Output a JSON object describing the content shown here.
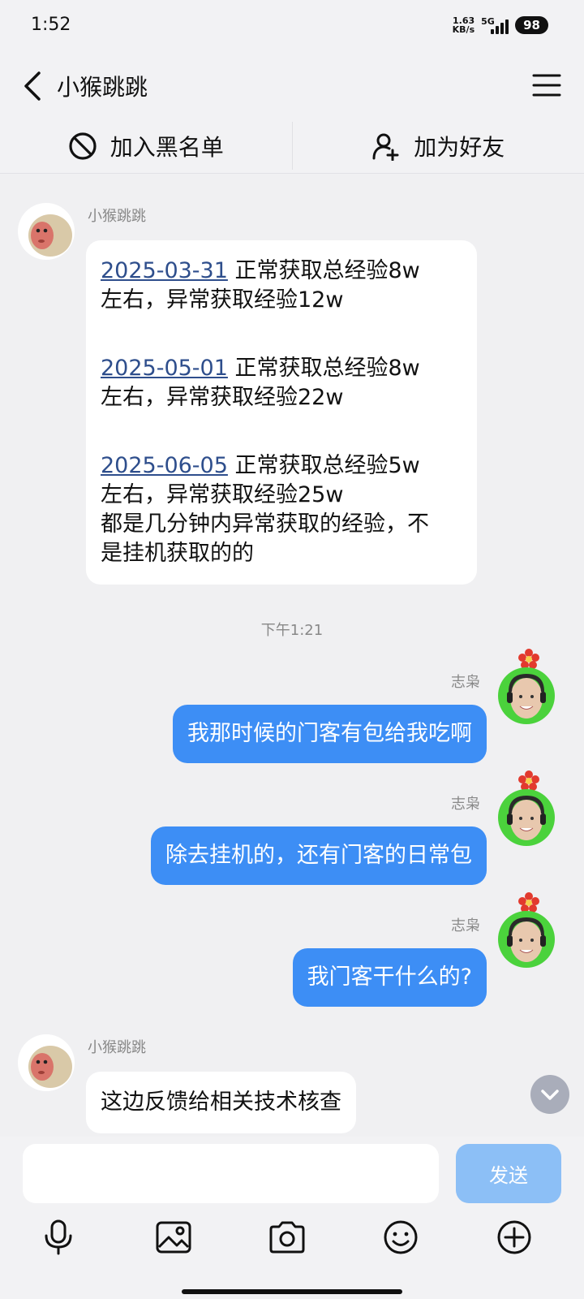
{
  "status_bar": {
    "time": "1:52",
    "net_speed_value": "1.63",
    "net_speed_unit": "KB/s",
    "network": "5G",
    "battery": "98"
  },
  "header": {
    "title": "小猴跳跳"
  },
  "actions": {
    "block_label": "加入黑名单",
    "add_friend_label": "加为好友"
  },
  "chat": {
    "first_message": {
      "sender": "小猴跳跳",
      "entries": [
        {
          "date": "2025-03-31",
          "text1": " 正常获取总经验8w",
          "text2": "左右，异常获取经验12w"
        },
        {
          "date": "2025-05-01",
          "text1": " 正常获取总经验8w",
          "text2": "左右，异常获取经验22w"
        },
        {
          "date": "2025-06-05",
          "text1": " 正常获取总经验5w",
          "text2": "左右，异常获取经验25w"
        }
      ],
      "footer_line1": "都是几分钟内异常获取的经验，不",
      "footer_line2": "是挂机获取的的"
    },
    "timestamp": "下午1:21",
    "outgoing": [
      {
        "sender": "志枭",
        "text": "我那时候的门客有包给我吃啊"
      },
      {
        "sender": "志枭",
        "text": "除去挂机的，还有门客的日常包"
      },
      {
        "sender": "志枭",
        "text": "我门客干什么的?"
      }
    ],
    "last_message": {
      "sender": "小猴跳跳",
      "text": "这边反馈给相关技术核查"
    }
  },
  "input": {
    "placeholder": "",
    "send_label": "发送"
  },
  "colors": {
    "outgoing_bubble": "#3D8EF5",
    "send_button": "#8CBFF6",
    "date_link": "#2E4E8C",
    "background": "#F0F0F2"
  }
}
